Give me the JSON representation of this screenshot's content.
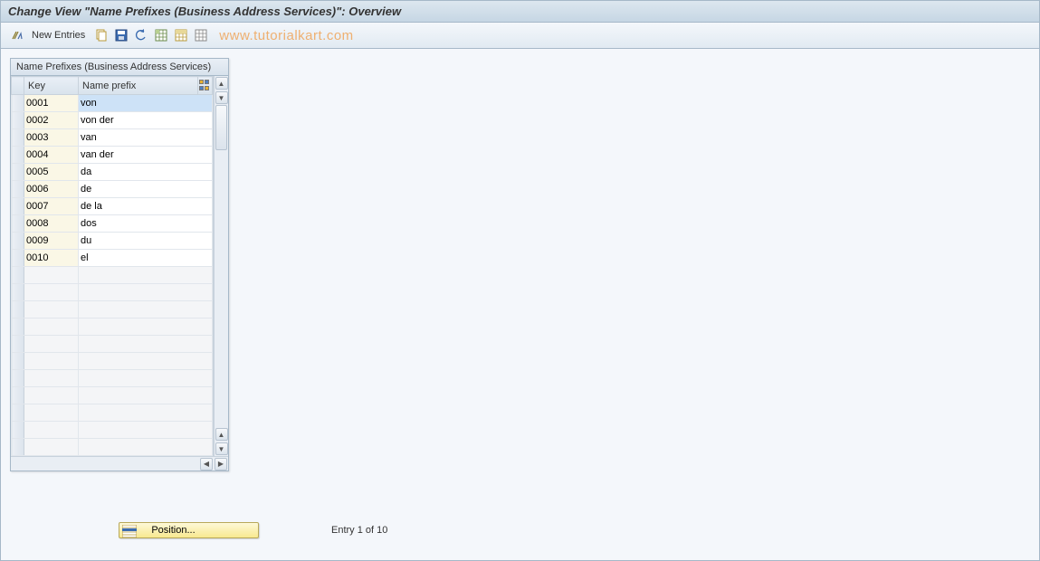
{
  "title": "Change View \"Name Prefixes (Business Address Services)\": Overview",
  "toolbar": {
    "new_entries_label": "New Entries",
    "watermark": "www.tutorialkart.com"
  },
  "panel": {
    "header": "Name Prefixes (Business Address Services)",
    "columns": {
      "key": "Key",
      "name": "Name prefix"
    },
    "rows": [
      {
        "key": "0001",
        "name": "von",
        "selected": true
      },
      {
        "key": "0002",
        "name": "von der"
      },
      {
        "key": "0003",
        "name": "van"
      },
      {
        "key": "0004",
        "name": "van der"
      },
      {
        "key": "0005",
        "name": "da"
      },
      {
        "key": "0006",
        "name": "de"
      },
      {
        "key": "0007",
        "name": "de la"
      },
      {
        "key": "0008",
        "name": "dos"
      },
      {
        "key": "0009",
        "name": "du"
      },
      {
        "key": "0010",
        "name": "el"
      }
    ],
    "empty_rows": 11
  },
  "footer": {
    "position_label": "Position...",
    "entry_status": "Entry 1 of 10"
  }
}
